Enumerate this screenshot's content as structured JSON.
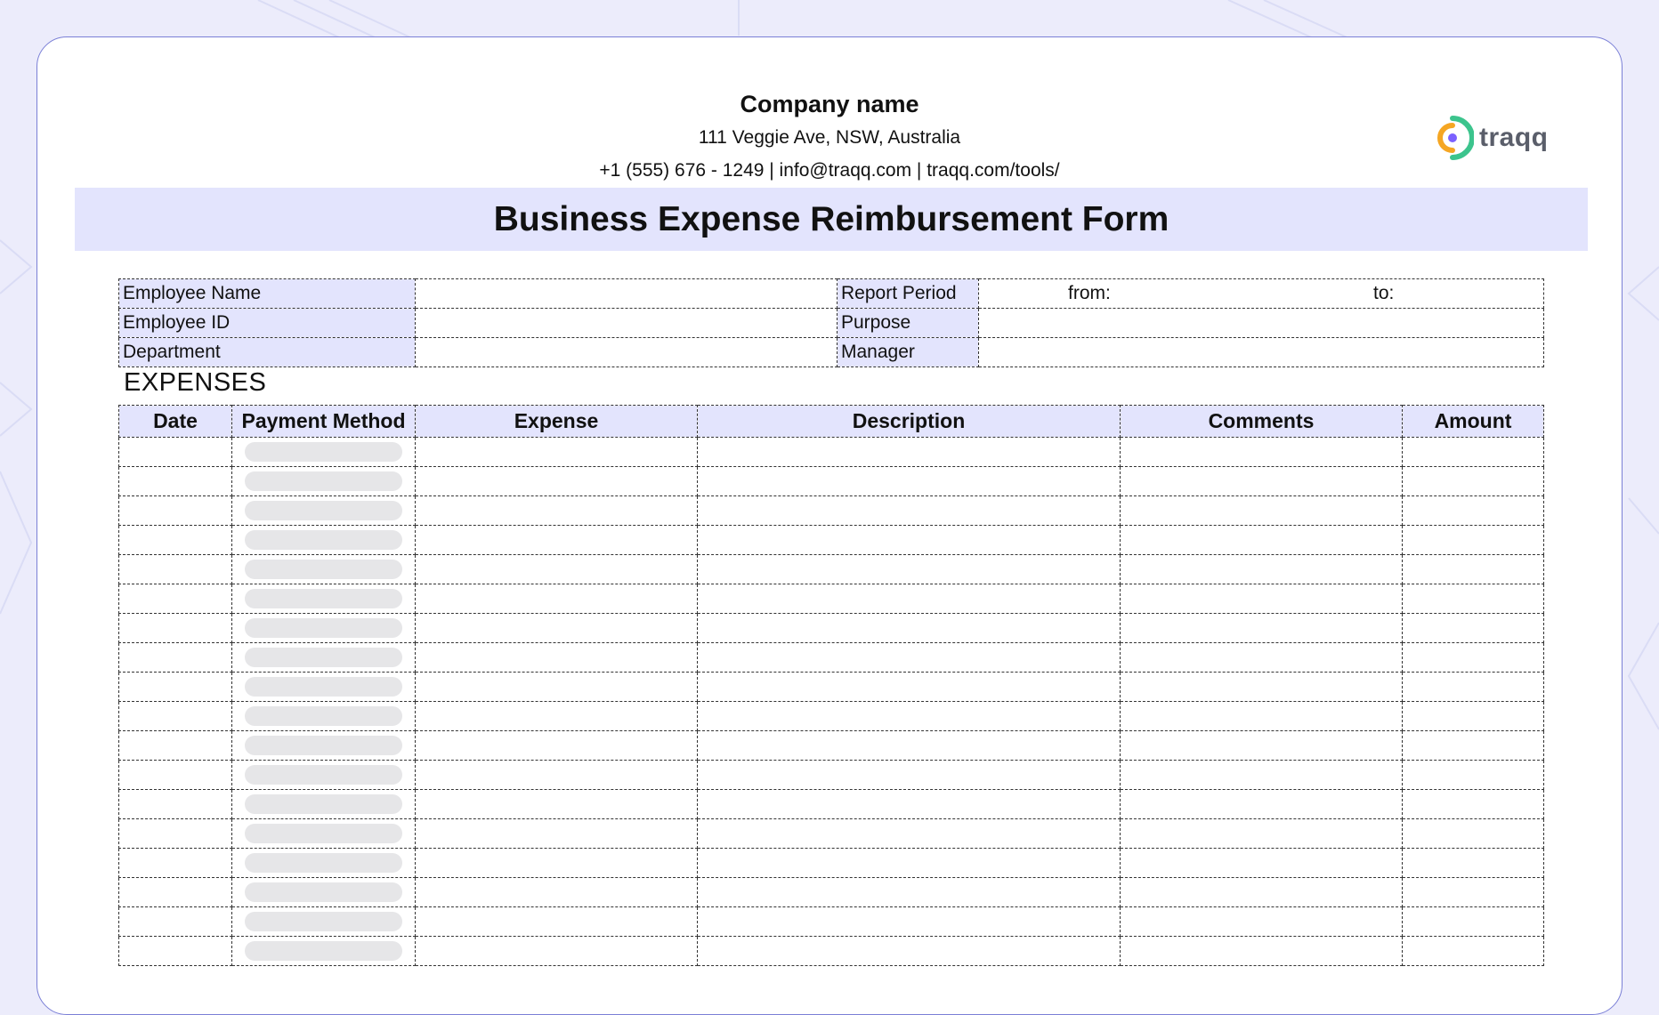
{
  "company": {
    "name": "Company name",
    "address": "111 Veggie Ave, NSW, Australia",
    "contact": "+1 (555) 676 - 1249 | info@traqq.com | traqq.com/tools/"
  },
  "logo": {
    "text": "traqq",
    "icon": "traqq-logo-icon",
    "colors": [
      "#f5a623",
      "#3cc48d",
      "#7b61ff"
    ]
  },
  "form_title": "Business Expense Reimbursement Form",
  "info": {
    "employee_name_label": "Employee Name",
    "employee_id_label": "Employee ID",
    "department_label": "Department",
    "report_period_label": "Report Period",
    "from_label": "from:",
    "to_label": "to:",
    "purpose_label": "Purpose",
    "manager_label": "Manager"
  },
  "expenses": {
    "section_title": "EXPENSES",
    "columns": [
      "Date",
      "Payment Method",
      "Expense",
      "Description",
      "Comments",
      "Amount"
    ],
    "row_count": 18
  },
  "colors": {
    "accent_fill": "#e3e4fd",
    "page_bg": "#ececfb",
    "border_accent": "#7a7fd6"
  }
}
